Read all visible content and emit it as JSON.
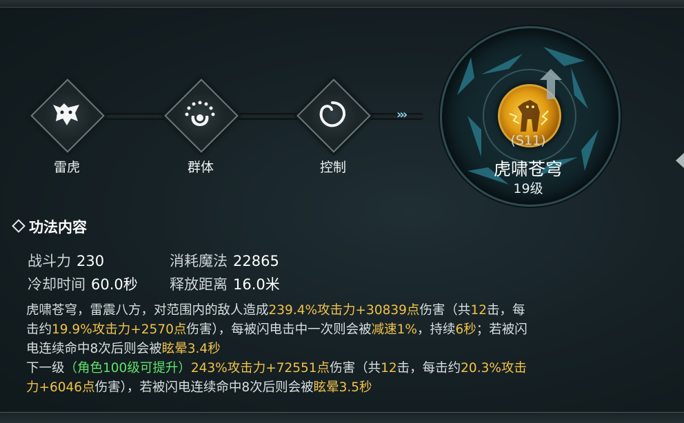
{
  "chain": {
    "nodes": [
      {
        "label": "雷虎",
        "icon": "tiger-head-icon"
      },
      {
        "label": "群体",
        "icon": "group-icon"
      },
      {
        "label": "控制",
        "icon": "swirl-icon"
      }
    ],
    "chevrons": "›››"
  },
  "skill": {
    "code": "(S11)",
    "name": "虎啸苍穹",
    "level": "19级",
    "icon": "golden-tiger-icon"
  },
  "section": {
    "title": "功法内容"
  },
  "stats": {
    "power_label": "战斗力",
    "power_value": "230",
    "mana_label": "消耗魔法",
    "mana_value": "22865",
    "cooldown_label": "冷却时间",
    "cooldown_value": "60.0秒",
    "range_label": "释放距离",
    "range_value": "16.0米"
  },
  "description": {
    "l1_a": "虎啸苍穹，雷震八方，对范围内的敌人造成",
    "l1_b": "239.4%攻击力+30839点",
    "l1_c": "伤害（共",
    "l1_d": "12",
    "l1_e": "击，每",
    "l2_a": "击约",
    "l2_b": "19.9%攻击力+2570点",
    "l2_c": "伤害），每被闪电击中一次则会被",
    "l2_d": "减速1%",
    "l2_e": "，持续",
    "l2_f": "6秒",
    "l2_g": "；若被闪",
    "l3_a": "电连续命中8次后则会被",
    "l3_b": "眩晕3.4秒",
    "l4_a": "下一级",
    "l4_b": "（角色100级可提升）",
    "l4_c": "243%攻击力+72551点",
    "l4_d": "伤害（共",
    "l4_e": "12",
    "l4_f": "击，每击约",
    "l4_g": "20.3%攻击",
    "l5_a": "力+6046点",
    "l5_b": "伤害），若被闪电连续命中8次后则会被",
    "l5_c": "眩晕3.5秒"
  },
  "colors": {
    "highlight": "#f2c249",
    "unlock": "#5fe36b",
    "text": "#d8dfe0"
  }
}
